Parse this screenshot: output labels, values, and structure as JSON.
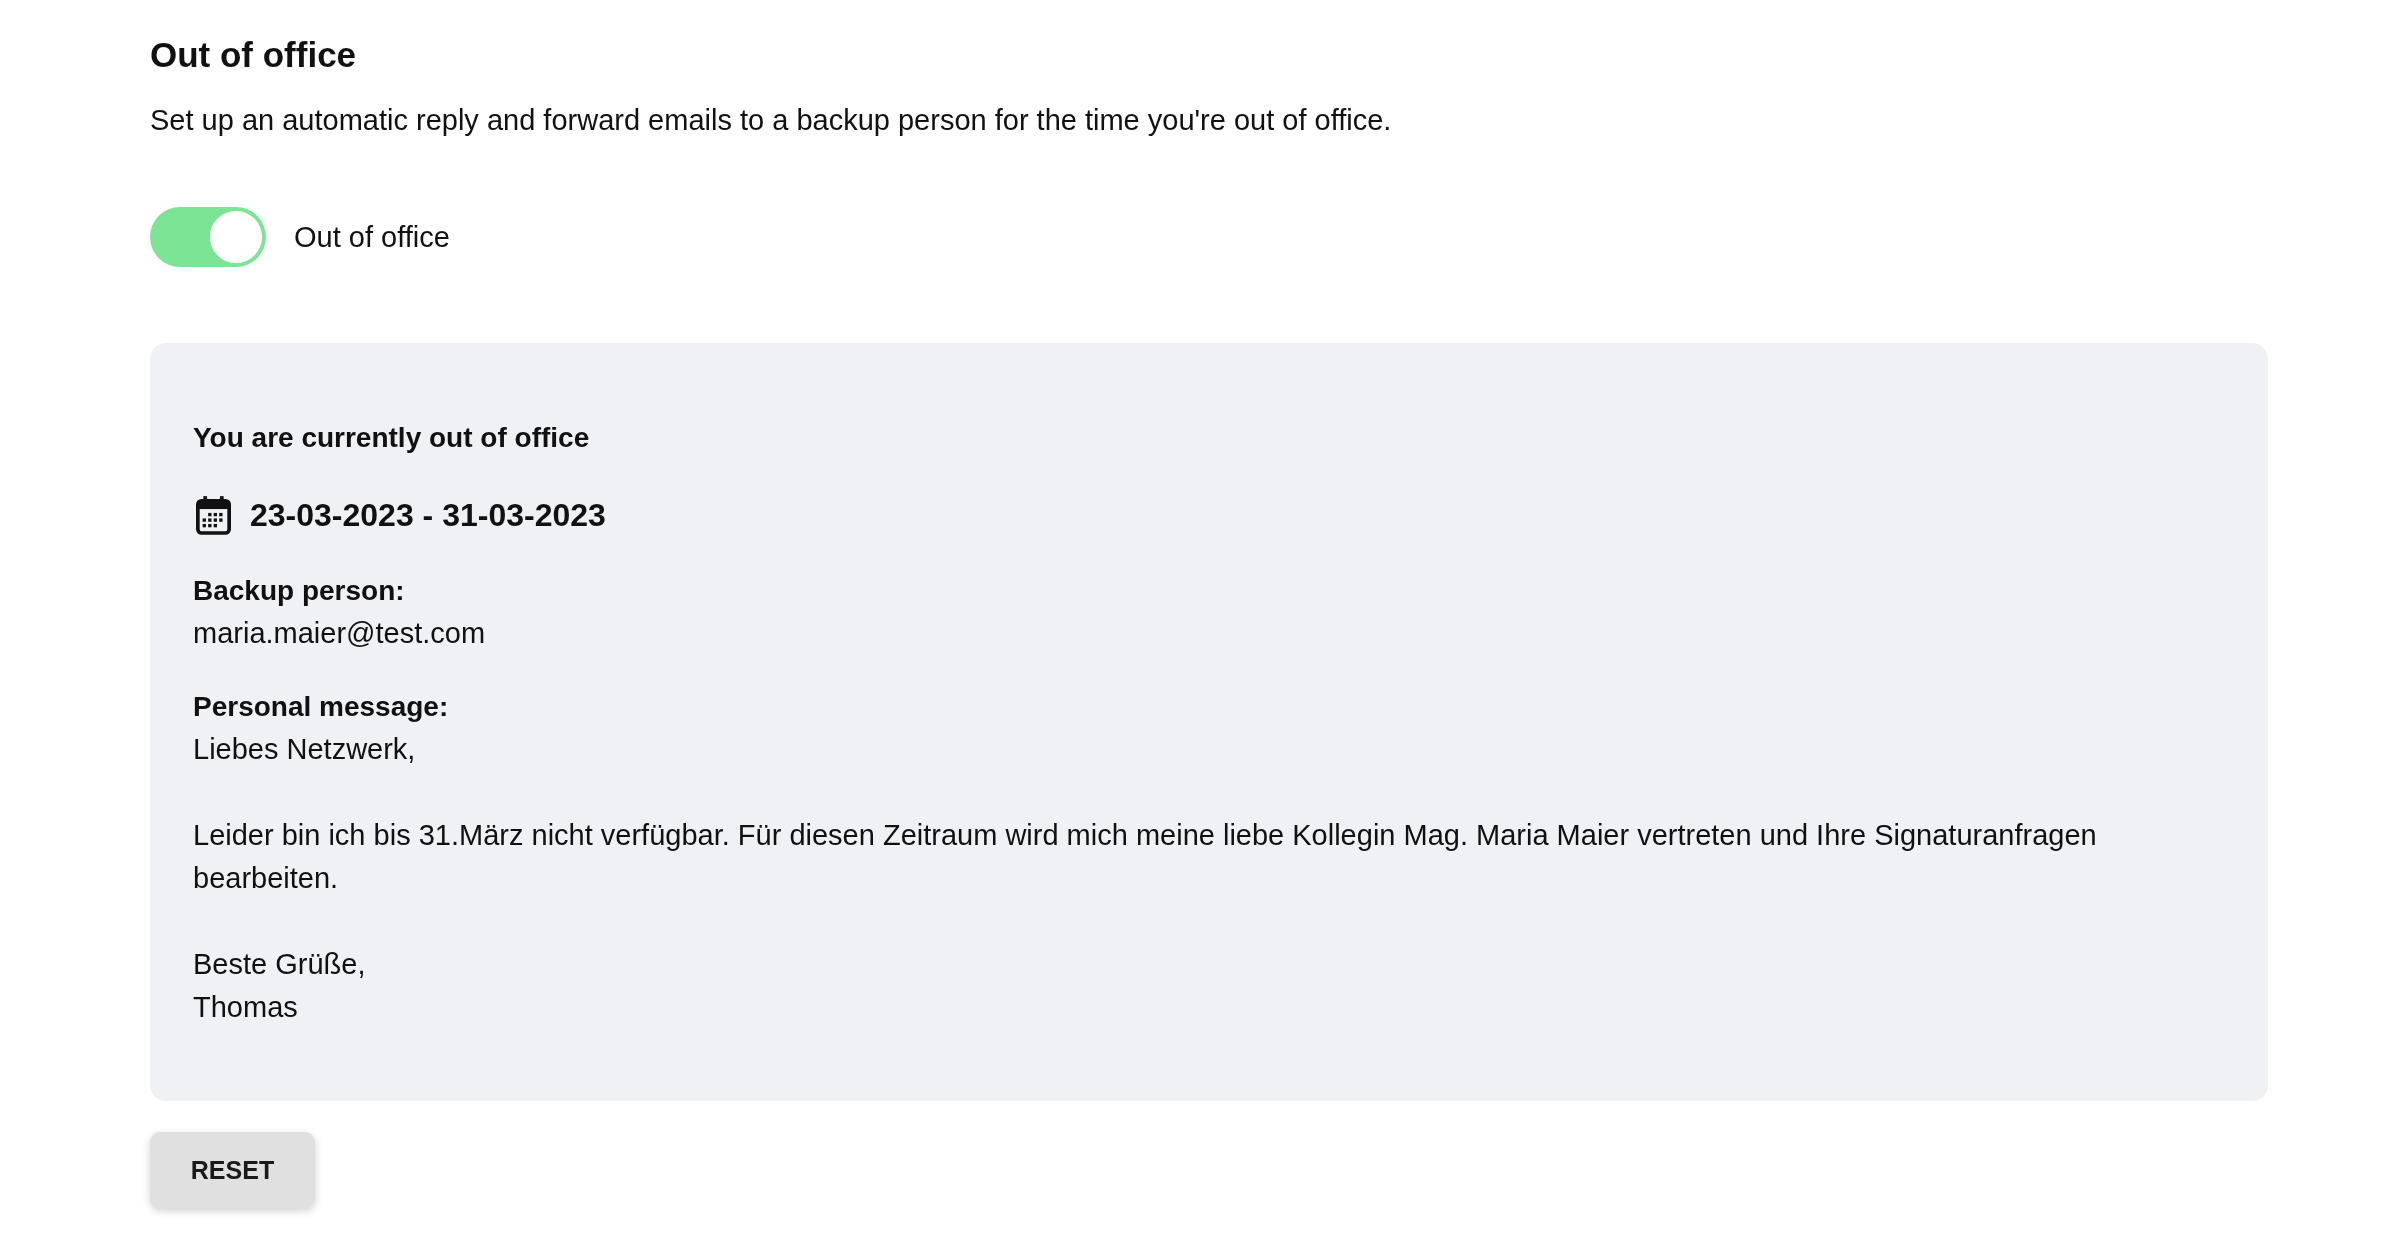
{
  "page": {
    "title": "Out of office",
    "description": "Set up an automatic reply and forward emails to a backup person for the time you're out of office."
  },
  "toggle": {
    "label": "Out of office",
    "on": true
  },
  "status_card": {
    "heading": "You are currently out of office",
    "date_range": "23-03-2023 - 31-03-2023",
    "backup_person": {
      "label": "Backup person:",
      "value": "maria.maier@test.com"
    },
    "personal_message": {
      "label": "Personal message:",
      "value": "Liebes Netzwerk,\n\nLeider bin ich bis 31.März nicht verfügbar. Für diesen Zeitraum wird mich meine liebe Kollegin Mag. Maria Maier vertreten und Ihre Signaturanfragen bearbeiten.\n\nBeste Grüße,\nThomas"
    }
  },
  "buttons": [
    {
      "label": "RESET"
    }
  ]
}
